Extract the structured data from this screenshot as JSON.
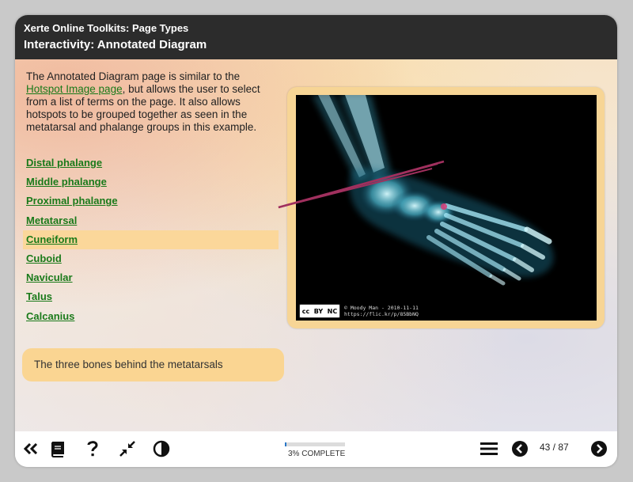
{
  "header": {
    "app_title": "Xerte Online Toolkits: Page Types",
    "page_title": "Interactivity: Annotated Diagram"
  },
  "intro": {
    "text_before": "The Annotated Diagram page is similar to the ",
    "link_text": "Hotspot Image page",
    "text_after": ", but allows the user to select from a list of terms on the page. It also allows hotspots to be grouped together as seen in the metatarsal and phalange groups in this example."
  },
  "terms": [
    {
      "label": "Distal phalange"
    },
    {
      "label": "Middle phalange"
    },
    {
      "label": "Proximal phalange"
    },
    {
      "label": "Metatarsal"
    },
    {
      "label": "Cuneiform"
    },
    {
      "label": "Cuboid"
    },
    {
      "label": "Navicular"
    },
    {
      "label": "Talus"
    },
    {
      "label": "Calcanius"
    }
  ],
  "selected_term": "Cuneiform",
  "feedback": "The three bones behind the metatarsals",
  "image_credit": {
    "badge": [
      "cc",
      "BY",
      "NC"
    ],
    "line1": "© Moody Man - 2010-11-11",
    "line2": "https://flic.kr/p/85BbNQ"
  },
  "footer": {
    "progress_percent": 3,
    "progress_text": "3% COMPLETE",
    "page_counter": "43 / 87"
  },
  "colors": {
    "header_bg": "#2c2c2c",
    "link_green": "#1a7a1a",
    "highlight": "#fbd79a",
    "leader_line": "#a0305e",
    "progress": "#2a78c8"
  },
  "icons": {
    "collapse": "double-chevron-left-icon",
    "glossary": "book-icon",
    "help": "question-mark-icon",
    "minimize": "shrink-arrows-icon",
    "contrast": "contrast-icon",
    "menu": "menu-icon",
    "prev": "arrow-left-circle-icon",
    "next": "arrow-right-circle-icon"
  }
}
